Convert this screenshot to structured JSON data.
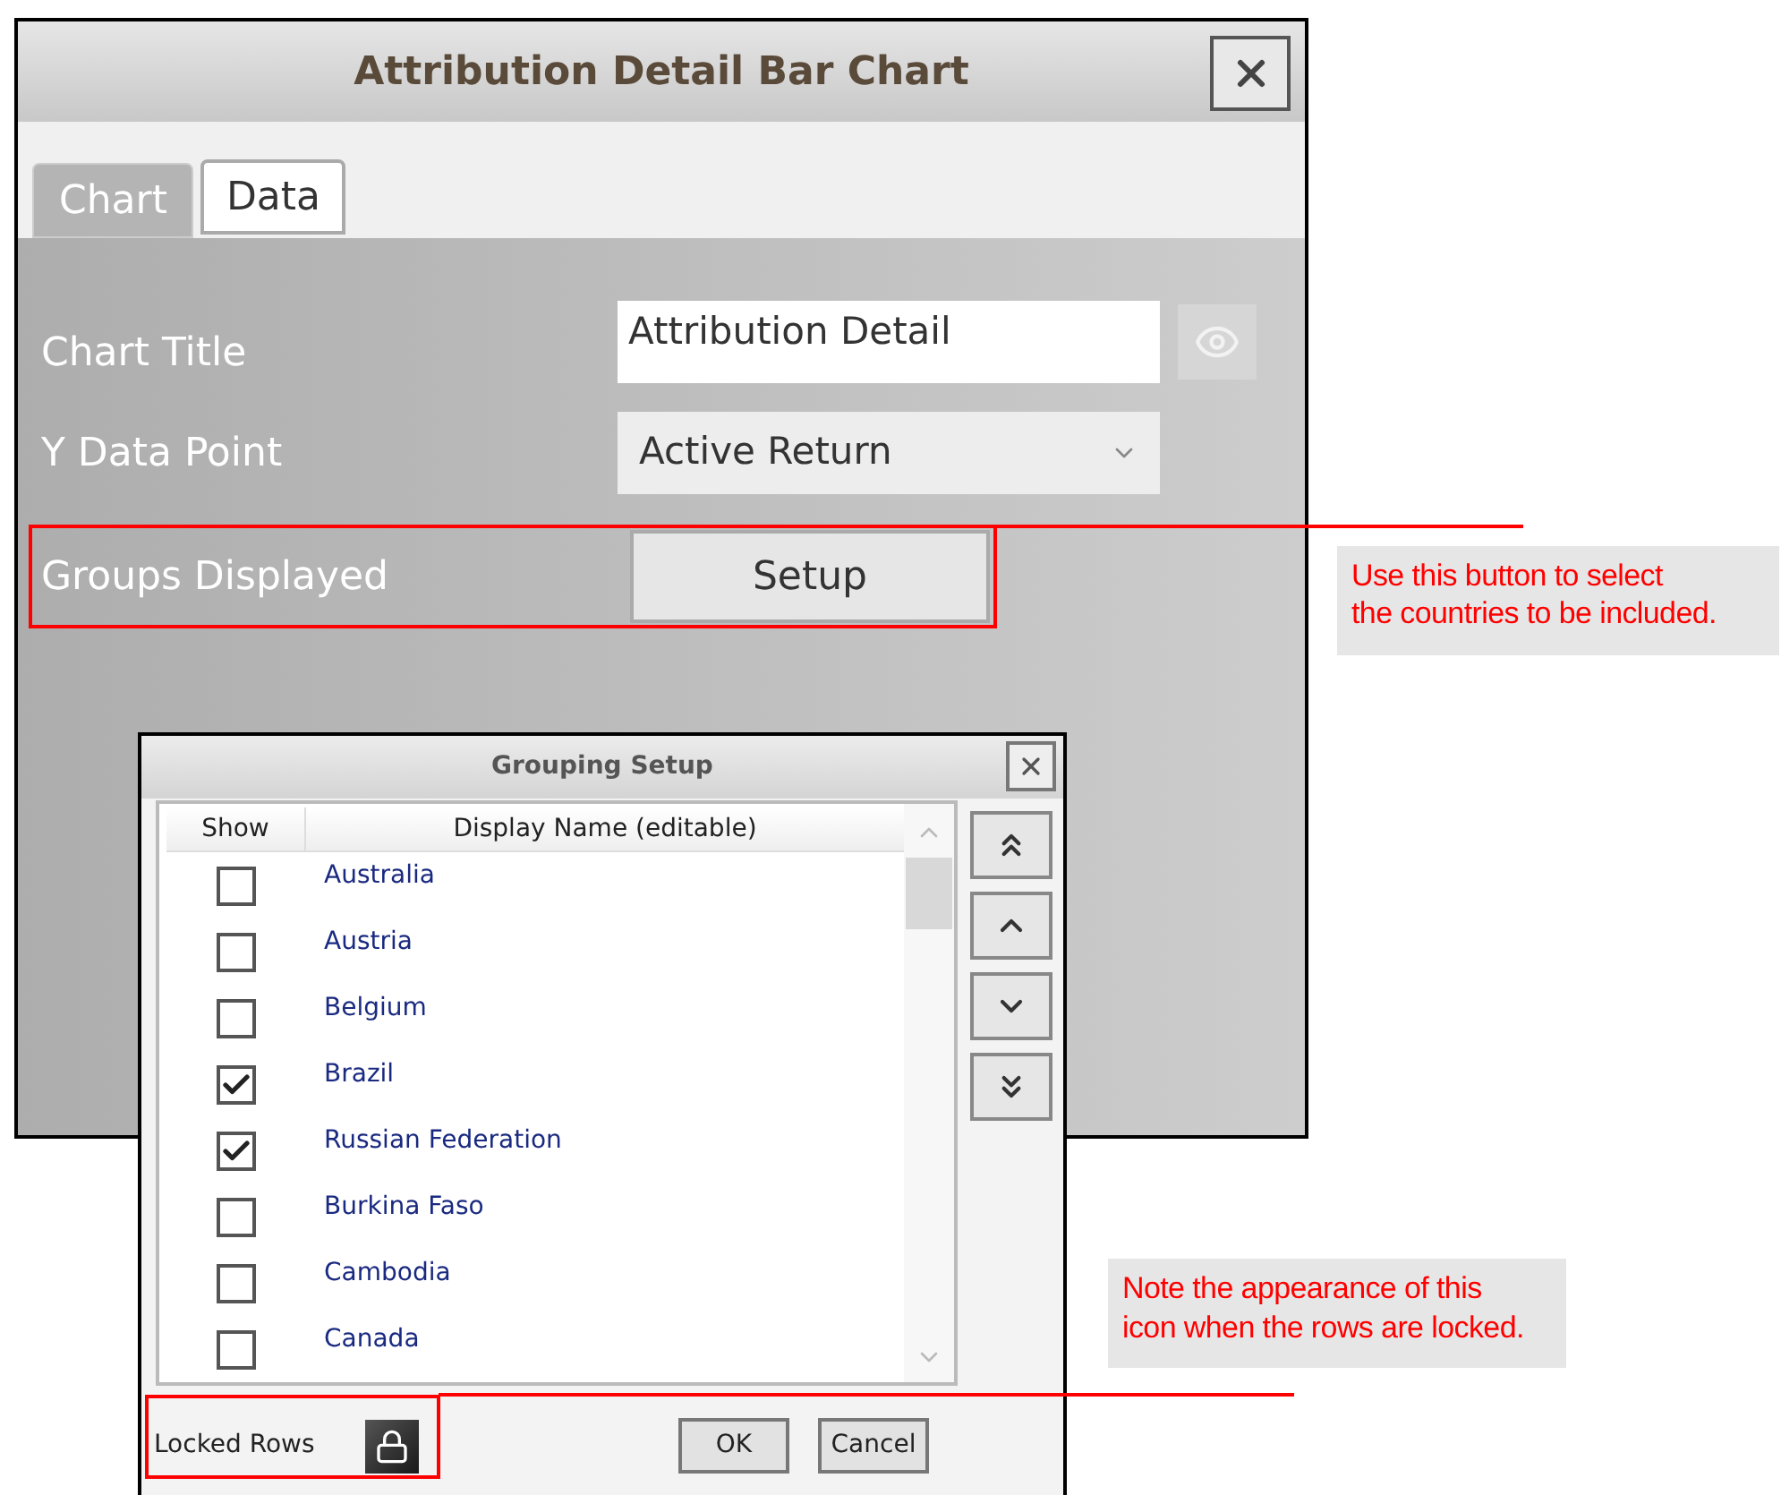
{
  "chart_dialog": {
    "title": "Attribution Detail Bar Chart",
    "tabs": [
      {
        "label": "Chart",
        "selected": true
      },
      {
        "label": "Data",
        "selected": false
      }
    ],
    "chart_title": {
      "label": "Chart Title",
      "value": "Attribution Detail"
    },
    "y_data_point": {
      "label": "Y Data Point",
      "value": "Active Return"
    },
    "groups_displayed": {
      "label": "Groups Displayed",
      "button": "Setup"
    }
  },
  "grouping_dialog": {
    "title": "Grouping Setup",
    "columns": [
      "Show",
      "Display Name (editable)"
    ],
    "rows": [
      {
        "name": "Australia",
        "checked": false
      },
      {
        "name": "Austria",
        "checked": false
      },
      {
        "name": "Belgium",
        "checked": false
      },
      {
        "name": "Brazil",
        "checked": true
      },
      {
        "name": "Russian Federation",
        "checked": true
      },
      {
        "name": "Burkina Faso",
        "checked": false
      },
      {
        "name": "Cambodia",
        "checked": false
      },
      {
        "name": "Canada",
        "checked": false
      }
    ],
    "locked_rows": {
      "label": "Locked Rows",
      "locked": true
    },
    "buttons": [
      "OK",
      "Cancel"
    ]
  },
  "callouts": [
    {
      "text": "Use this button to select\nthe countries to be included."
    },
    {
      "text": "Note the appearance of this\nicon when the rows are locked."
    }
  ]
}
